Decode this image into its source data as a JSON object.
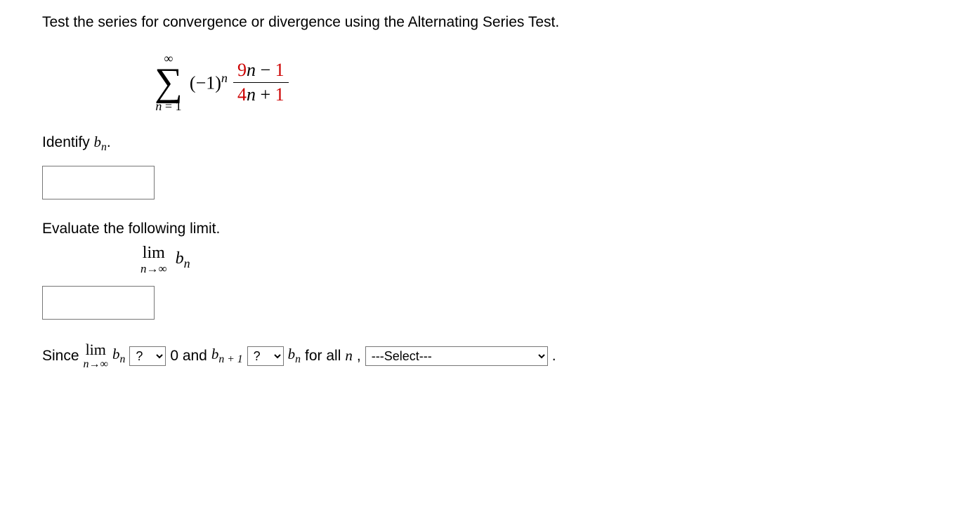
{
  "question": "Test the series for convergence or divergence using the Alternating Series Test.",
  "series": {
    "upper": "∞",
    "lower_var": "n",
    "lower_eq": " = ",
    "lower_val": "1",
    "base_open": "(−1)",
    "exp": "n",
    "num_coef": "9",
    "num_var": "n",
    "num_op": " − ",
    "num_const": "1",
    "den_coef": "4",
    "den_var": "n",
    "den_op": " + ",
    "den_const": "1"
  },
  "identify": {
    "pre": "Identify ",
    "b": "b",
    "sub": "n",
    "post": "."
  },
  "evaluate_prompt": "Evaluate the following limit.",
  "limit": {
    "lim": "lim",
    "arrow_var": "n",
    "arrow": "→∞",
    "b": "b",
    "sub": "n"
  },
  "final": {
    "since": "Since ",
    "lim": "lim",
    "arrow_var": "n",
    "arrow": "→∞",
    "b1": "b",
    "b1sub": "n",
    "zero_and": " 0 and ",
    "b2": "b",
    "b2sub": "n + 1",
    "b3": "b",
    "b3sub": "n",
    "for_all": " for all ",
    "nvar": "n",
    "comma": ", ",
    "period": " .",
    "select1": "?",
    "select2": "?",
    "select3": "---Select---"
  }
}
